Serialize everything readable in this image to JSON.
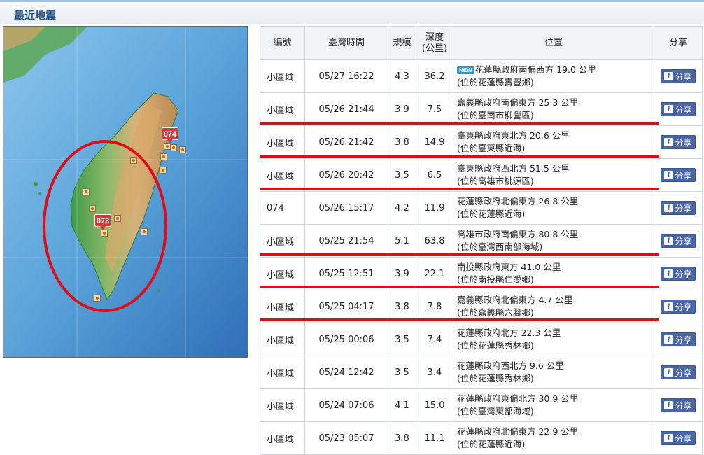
{
  "header": {
    "title": "最近地震"
  },
  "map": {
    "markers": [
      {
        "label": "074"
      },
      {
        "label": "073"
      }
    ]
  },
  "table": {
    "headers": {
      "number": "編號",
      "time": "臺灣時間",
      "magnitude": "規模",
      "depth_line1": "深度",
      "depth_line2": "(公里)",
      "location": "位置",
      "share": "分享"
    },
    "new_badge": "NEW",
    "share_label": "分享",
    "share_icon": "f",
    "rows": [
      {
        "number": "小區域",
        "time": "05/27 16:22",
        "magnitude": "4.3",
        "depth": "36.2",
        "loc1": "花蓮縣政府南偏西方 19.0 公里",
        "loc2": "(位於花蓮縣壽豐鄉)",
        "is_new": true
      },
      {
        "number": "小區域",
        "time": "05/26 21:44",
        "magnitude": "3.9",
        "depth": "7.5",
        "loc1": "嘉義縣政府南偏東方 25.3 公里",
        "loc2": "(位於臺南市柳營區)"
      },
      {
        "number": "小區域",
        "time": "05/26 21:42",
        "magnitude": "3.8",
        "depth": "14.9",
        "loc1": "臺東縣政府東北方 20.6 公里",
        "loc2": "(位於臺東縣近海)"
      },
      {
        "number": "小區域",
        "time": "05/26 20:42",
        "magnitude": "3.5",
        "depth": "6.5",
        "loc1": "臺東縣政府西北方 51.5 公里",
        "loc2": "(位於高雄市桃源區)"
      },
      {
        "number": "074",
        "time": "05/26 15:17",
        "magnitude": "4.2",
        "depth": "11.9",
        "loc1": "花蓮縣政府北偏東方 26.8 公里",
        "loc2": "(位於花蓮縣近海)"
      },
      {
        "number": "小區域",
        "time": "05/25 21:54",
        "magnitude": "5.1",
        "depth": "63.8",
        "loc1": "高雄市政府南偏東方 80.8 公里",
        "loc2": "(位於臺灣西南部海域)"
      },
      {
        "number": "小區域",
        "time": "05/25 12:51",
        "magnitude": "3.9",
        "depth": "22.1",
        "loc1": "南投縣政府東方 41.0 公里",
        "loc2": "(位於南投縣仁愛鄉)"
      },
      {
        "number": "小區域",
        "time": "05/25 04:17",
        "magnitude": "3.8",
        "depth": "7.8",
        "loc1": "嘉義縣政府北偏東方 4.7 公里",
        "loc2": "(位於嘉義縣六腳鄉)"
      },
      {
        "number": "小區域",
        "time": "05/25 00:06",
        "magnitude": "3.5",
        "depth": "7.4",
        "loc1": "花蓮縣政府北方 22.3 公里",
        "loc2": "(位於花蓮縣秀林鄉)"
      },
      {
        "number": "小區域",
        "time": "05/24 12:42",
        "magnitude": "3.5",
        "depth": "3.4",
        "loc1": "花蓮縣政府西北方 9.6 公里",
        "loc2": "(位於花蓮縣秀林鄉)"
      },
      {
        "number": "小區域",
        "time": "05/24 07:06",
        "magnitude": "4.1",
        "depth": "15.0",
        "loc1": "花蓮縣政府東偏北方 30.9 公里",
        "loc2": "(位於臺灣東部海域)"
      },
      {
        "number": "小區域",
        "time": "05/23 05:07",
        "magnitude": "3.8",
        "depth": "11.1",
        "loc1": "花蓮縣政府北偏東方 22.9 公里",
        "loc2": "(位於花蓮縣近海)"
      }
    ]
  },
  "colors": {
    "header_title": "#1f4f86",
    "highlight": "#e00c17",
    "share_button": "#4a66a4",
    "new_badge": "#2b9bd6"
  }
}
